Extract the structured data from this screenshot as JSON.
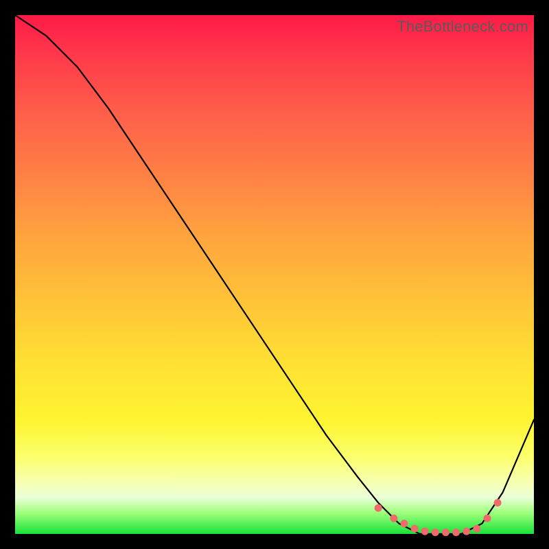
{
  "watermark": "TheBottleneck.com",
  "colors": {
    "curve": "#000000",
    "dot": "#ef6b6b",
    "frame": "#000000"
  },
  "chart_data": {
    "type": "line",
    "title": "",
    "xlabel": "",
    "ylabel": "",
    "xlim": [
      0,
      100
    ],
    "ylim": [
      0,
      100
    ],
    "grid": false,
    "legend": false,
    "series": [
      {
        "name": "bottleneck-curve",
        "x": [
          0,
          6,
          12,
          18,
          24,
          30,
          36,
          42,
          48,
          54,
          60,
          66,
          70,
          74,
          78,
          82,
          86,
          90,
          94,
          100
        ],
        "y": [
          100,
          96,
          90,
          82,
          73,
          64,
          55,
          46,
          37,
          28,
          19,
          11,
          6,
          2,
          0,
          0,
          0,
          2,
          8,
          22
        ]
      }
    ],
    "markers": {
      "name": "optimal-range-dots",
      "x": [
        70,
        73,
        75,
        77,
        79,
        81,
        83,
        85,
        87,
        89,
        91,
        93
      ],
      "y": [
        5,
        3,
        2,
        1,
        0.5,
        0.3,
        0.3,
        0.3,
        0.5,
        1,
        3,
        6
      ]
    }
  }
}
